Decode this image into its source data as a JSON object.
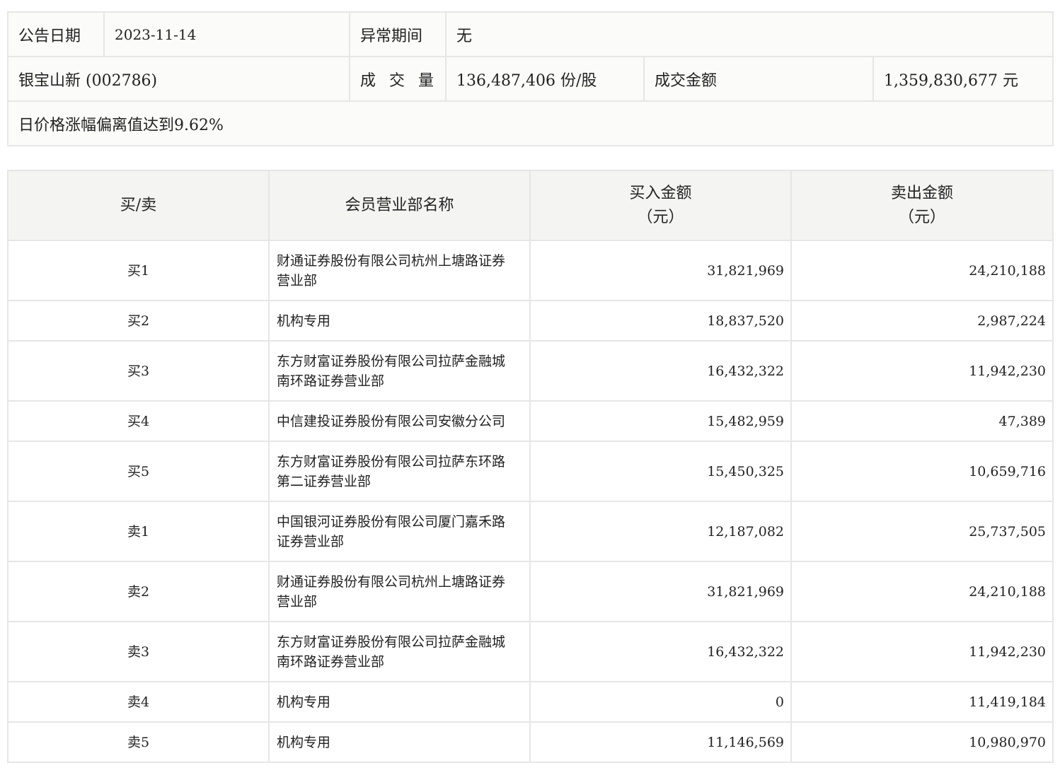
{
  "info": {
    "date_label": "公告日期",
    "date_value": "2023-11-14",
    "period_label": "异常期间",
    "period_value": "无",
    "stock_name": "银宝山新 (002786)",
    "volume_label": "成 交 量",
    "volume_value": "136,487,406 份/股",
    "amount_label": "成交金额",
    "amount_value": "1,359,830,677 元",
    "note": "日价格涨幅偏离值达到9.62%"
  },
  "table": {
    "headers": {
      "type": "买/卖",
      "name": "会员营业部名称",
      "buy_title": "买入金额",
      "buy_unit": "（元）",
      "sell_title": "卖出金额",
      "sell_unit": "（元）"
    },
    "rows": [
      {
        "type": "买1",
        "name": "财通证券股份有限公司杭州上塘路证券营业部",
        "buy": "31,821,969",
        "sell": "24,210,188"
      },
      {
        "type": "买2",
        "name": "机构专用",
        "buy": "18,837,520",
        "sell": "2,987,224"
      },
      {
        "type": "买3",
        "name": "东方财富证券股份有限公司拉萨金融城南环路证券营业部",
        "buy": "16,432,322",
        "sell": "11,942,230"
      },
      {
        "type": "买4",
        "name": "中信建投证券股份有限公司安徽分公司",
        "buy": "15,482,959",
        "sell": "47,389"
      },
      {
        "type": "买5",
        "name": "东方财富证券股份有限公司拉萨东环路第二证券营业部",
        "buy": "15,450,325",
        "sell": "10,659,716"
      },
      {
        "type": "卖1",
        "name": "中国银河证券股份有限公司厦门嘉禾路证券营业部",
        "buy": "12,187,082",
        "sell": "25,737,505"
      },
      {
        "type": "卖2",
        "name": "财通证券股份有限公司杭州上塘路证券营业部",
        "buy": "31,821,969",
        "sell": "24,210,188"
      },
      {
        "type": "卖3",
        "name": "东方财富证券股份有限公司拉萨金融城南环路证券营业部",
        "buy": "16,432,322",
        "sell": "11,942,230"
      },
      {
        "type": "卖4",
        "name": "机构专用",
        "buy": "0",
        "sell": "11,419,184"
      },
      {
        "type": "卖5",
        "name": "机构专用",
        "buy": "11,146,569",
        "sell": "10,980,970"
      }
    ]
  }
}
